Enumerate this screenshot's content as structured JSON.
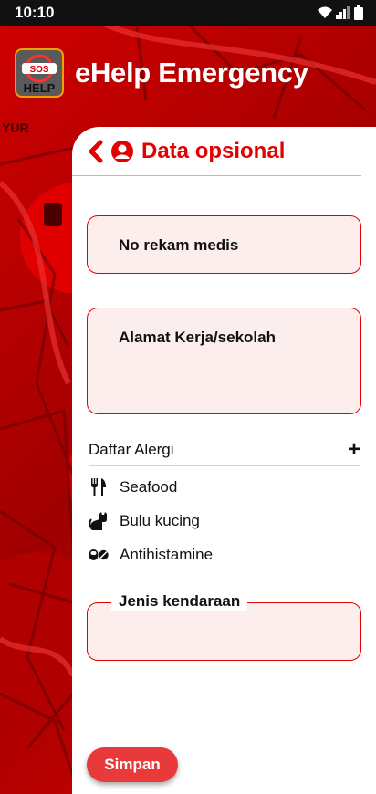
{
  "status_bar": {
    "time": "10:10"
  },
  "header": {
    "app_title": "eHelp Emergency",
    "logo_text_top": "SOS",
    "logo_text_bottom": "HELP"
  },
  "map_labels": {
    "street": "YUR"
  },
  "panel": {
    "title": "Data opsional"
  },
  "fields": {
    "medical_record": "No rekam medis",
    "work_address": "Alamat Kerja/sekolah",
    "vehicle_type": "Jenis kendaraan"
  },
  "allergies": {
    "title": "Daftar Alergi",
    "add_label": "+",
    "items": [
      {
        "label": "Seafood",
        "icon": "utensils-icon"
      },
      {
        "label": "Bulu kucing",
        "icon": "cat-icon"
      },
      {
        "label": "Antihistamine",
        "icon": "pills-icon"
      }
    ]
  },
  "actions": {
    "save_label": "Simpan"
  },
  "colors": {
    "accent": "#e30000",
    "field_bg": "#fdeeee",
    "save_button": "#e83a3a"
  }
}
